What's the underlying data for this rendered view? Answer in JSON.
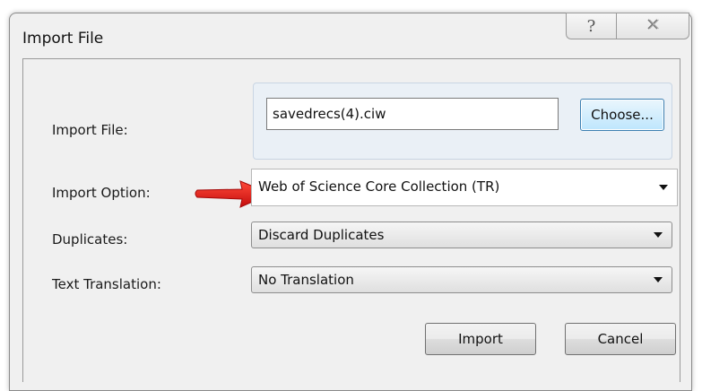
{
  "window": {
    "title": "Import File",
    "help_glyph": "?",
    "close_glyph": "☒"
  },
  "form": {
    "import_file": {
      "label": "Import File:",
      "value": "savedrecs(4).ciw",
      "choose_label": "Choose..."
    },
    "import_option": {
      "label": "Import Option:",
      "selected": "Web of Science Core Collection (TR)"
    },
    "duplicates": {
      "label": "Duplicates:",
      "selected": "Discard Duplicates"
    },
    "text_translation": {
      "label": "Text Translation:",
      "selected": "No Translation"
    }
  },
  "actions": {
    "import_label": "Import",
    "cancel_label": "Cancel"
  },
  "colors": {
    "annotation_arrow": "#e31b1b",
    "choose_button_border": "#3c7fb1"
  },
  "icons": {
    "help": "help-icon",
    "close": "close-icon",
    "annotation": "red-arrow-icon"
  }
}
